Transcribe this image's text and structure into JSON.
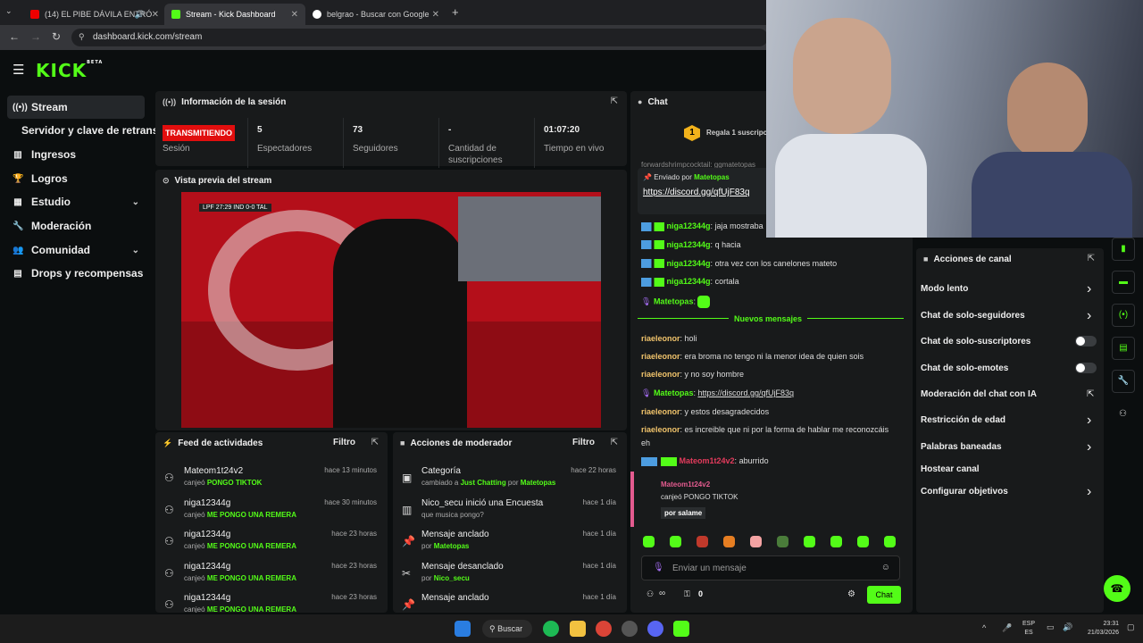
{
  "browser": {
    "tabs": [
      {
        "label": "(14) EL PIBE DÁVILA ENTRÓ",
        "active": false
      },
      {
        "label": "Stream - Kick Dashboard",
        "active": true
      },
      {
        "label": "belgrao - Buscar con Google",
        "active": false
      }
    ],
    "url": "dashboard.kick.com/stream"
  },
  "logo": {
    "text": "KICK",
    "beta": "BETA"
  },
  "sidebar": {
    "items": [
      {
        "label": "Stream"
      },
      {
        "label": "Servidor y clave de retransm"
      },
      {
        "label": "Ingresos"
      },
      {
        "label": "Logros"
      },
      {
        "label": "Estudio"
      },
      {
        "label": "Moderación"
      },
      {
        "label": "Comunidad"
      },
      {
        "label": "Drops y recompensas"
      }
    ]
  },
  "session": {
    "title": "Información de la sesión",
    "live_badge": "TRANSMITIENDO",
    "session_label": "Sesión",
    "stats": [
      {
        "value": "5",
        "label": "Espectadores"
      },
      {
        "value": "73",
        "label": "Seguidores"
      },
      {
        "value": "-",
        "label": "Cantidad de suscripciones"
      },
      {
        "value": "01:07:20",
        "label": "Tiempo en vivo"
      }
    ]
  },
  "preview": {
    "title": "Vista previa del stream",
    "score": "LPF 27:29 IND 0-0 TAL"
  },
  "feed": {
    "title": "Feed de actividades",
    "filter": "Filtro",
    "items": [
      {
        "name": "Mateom1t24v2",
        "prefix": "canjeó",
        "reward": "PONGO TIKTOK",
        "time": "hace 13 minutos"
      },
      {
        "name": "niga12344g",
        "prefix": "canjeó",
        "reward": "ME PONGO UNA REMERA",
        "time": "hace 30 minutos"
      },
      {
        "name": "niga12344g",
        "prefix": "canjeó",
        "reward": "ME PONGO UNA REMERA",
        "time": "hace 23 horas"
      },
      {
        "name": "niga12344g",
        "prefix": "canjeó",
        "reward": "ME PONGO UNA REMERA",
        "time": "hace 23 horas"
      },
      {
        "name": "niga12344g",
        "prefix": "canjeó",
        "reward": "ME PONGO UNA REMERA",
        "time": "hace 23 horas"
      }
    ]
  },
  "modactions": {
    "title": "Acciones de moderador",
    "filter": "Filtro",
    "items": [
      {
        "title": "Categoría",
        "sub1": "cambiado a ",
        "hl": "Just Chatting",
        "sub2": " por ",
        "by": "Matetopas",
        "time": "hace 22 horas"
      },
      {
        "title": "Nico_secu inició una Encuesta",
        "sub1": "que musica pongo?",
        "hl": "",
        "sub2": "",
        "by": "",
        "time": "hace 1 día"
      },
      {
        "title": "Mensaje anclado",
        "sub1": "por ",
        "hl": "",
        "sub2": "",
        "by": "Matetopas",
        "time": "hace 1 día"
      },
      {
        "title": "Mensaje desanclado",
        "sub1": "por ",
        "hl": "",
        "sub2": "",
        "by": "Nico_secu",
        "time": "hace 1 día"
      },
      {
        "title": "Mensaje anclado",
        "sub1": "",
        "hl": "",
        "sub2": "",
        "by": "",
        "time": "hace 1 día"
      }
    ]
  },
  "chat": {
    "title": "Chat",
    "gift": "Regala 1 suscripc",
    "pinned_by": "Enviado por",
    "pinned_user": "Matetopas",
    "pinned_link": "https://discord.gg/qfUjF83q",
    "clipped": "forwardshrimpcocktail: ggmatetopas",
    "messages": [
      {
        "user": "niga12344g",
        "text": "jaja mostraba"
      },
      {
        "user": "niga12344g",
        "text": "q hacia"
      },
      {
        "user": "niga12344g",
        "text": "otra vez con los canelones mateto"
      },
      {
        "user": "niga12344g",
        "text": "cortala"
      },
      {
        "user": "Matetopas",
        "text": ""
      }
    ],
    "new_messages": "Nuevos mensajes",
    "messages2": [
      {
        "user": "riaeleonor",
        "text": "holi"
      },
      {
        "user": "riaeleonor",
        "text": "era broma    no tengo ni la menor idea de quien sois"
      },
      {
        "user": "riaeleonor",
        "text": "y no soy hombre"
      },
      {
        "user": "Matetopas",
        "text": "https://discord.gg/qfUjF83q"
      },
      {
        "user": "riaeleonor",
        "text": "y estos desagradecidos"
      },
      {
        "user": "riaeleonor",
        "text": "es increible que ni por la forma de hablar me reconozcáis"
      },
      {
        "user": "",
        "text": "eh"
      },
      {
        "user": "Mateom1t24v2",
        "text": "aburrido"
      }
    ],
    "redeem": {
      "user": "Mateom1t24v2",
      "text": "canjeó PONGO TIKTOK",
      "note": "por salame"
    },
    "input_placeholder": "Enviar un mensaje",
    "counter": "0",
    "send": "Chat",
    "loop": "∞"
  },
  "channel_actions": {
    "title": "Acciones de canal",
    "items": [
      "Modo lento",
      "Chat de solo-seguidores",
      "Chat de solo-suscriptores",
      "Chat de solo-emotes",
      "Moderación del chat con IA",
      "Restricción de edad",
      "Palabras baneadas",
      "Hostear canal",
      "Configurar objetivos"
    ]
  },
  "taskbar": {
    "search": "Buscar",
    "lang1": "ESP",
    "lang2": "ES",
    "time": "23:31",
    "date": "21/03/2026"
  },
  "colors": {
    "accent": "#53fc18",
    "live": "#e10e0e",
    "bg": "#0b0e0f",
    "panel": "#181a1b"
  }
}
